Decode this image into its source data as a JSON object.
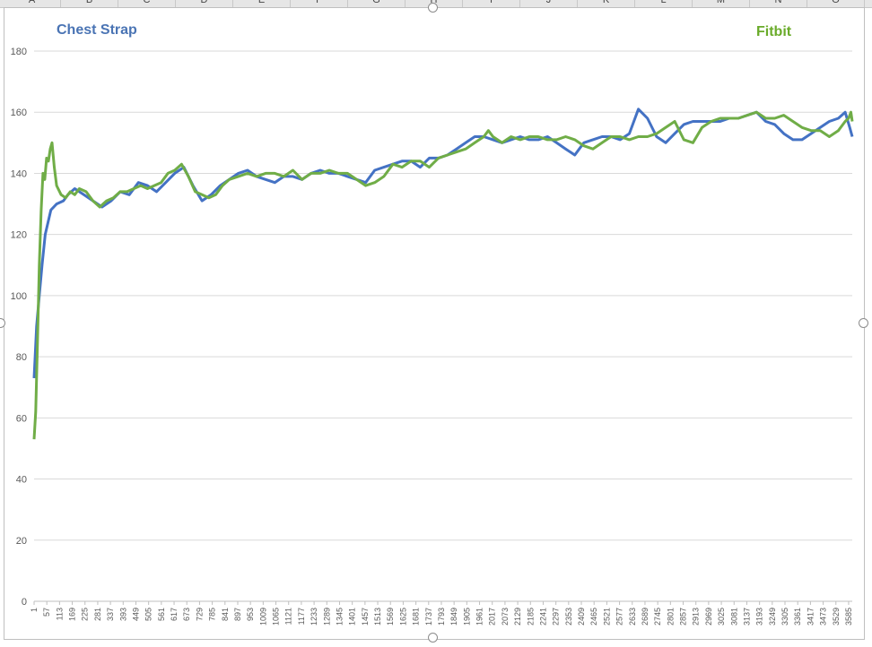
{
  "sheet": {
    "columns": [
      "A",
      "B",
      "C",
      "D",
      "E",
      "F",
      "G",
      "H",
      "I",
      "J",
      "K",
      "L",
      "M",
      "N",
      "O"
    ]
  },
  "legend": {
    "chest_strap": "Chest Strap",
    "fitbit": "Fitbit"
  },
  "colors": {
    "chest_strap": "#4472c4",
    "fitbit": "#70ad47",
    "legend_blue": "#4a74b4",
    "legend_green": "#6aab2a",
    "grid": "#d9d9d9"
  },
  "chart_data": {
    "type": "line",
    "title": "",
    "xlabel": "",
    "ylabel": "",
    "ylim": [
      0,
      180
    ],
    "yticks": [
      0,
      20,
      40,
      60,
      80,
      100,
      120,
      140,
      160,
      180
    ],
    "xlim": [
      1,
      3601
    ],
    "xticks": [
      "1",
      "57",
      "113",
      "169",
      "225",
      "281",
      "337",
      "393",
      "449",
      "505",
      "561",
      "617",
      "673",
      "729",
      "785",
      "841",
      "897",
      "953",
      "1009",
      "1065",
      "1121",
      "1177",
      "1233",
      "1289",
      "1345",
      "1401",
      "1457",
      "1513",
      "1569",
      "1625",
      "1681",
      "1737",
      "1793",
      "1849",
      "1905",
      "1961",
      "2017",
      "2073",
      "2129",
      "2185",
      "2241",
      "2297",
      "2353",
      "2409",
      "2465",
      "2521",
      "2577",
      "2633",
      "2689",
      "2745",
      "2801",
      "2857",
      "2913",
      "2969",
      "3025",
      "3081",
      "3137",
      "3193",
      "3249",
      "3305",
      "3361",
      "3417",
      "3473",
      "3529",
      "3585"
    ],
    "grid": true,
    "legend_placement": "top",
    "series": [
      {
        "name": "Chest Strap",
        "x": [
          1,
          12,
          24,
          36,
          50,
          75,
          100,
          130,
          150,
          180,
          220,
          260,
          300,
          340,
          380,
          420,
          460,
          500,
          540,
          580,
          620,
          660,
          700,
          740,
          780,
          820,
          860,
          900,
          940,
          980,
          1020,
          1060,
          1100,
          1140,
          1180,
          1220,
          1260,
          1300,
          1340,
          1380,
          1420,
          1460,
          1500,
          1540,
          1580,
          1620,
          1660,
          1700,
          1740,
          1780,
          1820,
          1860,
          1900,
          1940,
          1980,
          2020,
          2060,
          2100,
          2140,
          2180,
          2220,
          2260,
          2300,
          2340,
          2380,
          2420,
          2460,
          2500,
          2540,
          2580,
          2620,
          2660,
          2700,
          2740,
          2780,
          2820,
          2860,
          2900,
          2940,
          2980,
          3020,
          3060,
          3100,
          3140,
          3180,
          3220,
          3260,
          3300,
          3340,
          3380,
          3420,
          3460,
          3500,
          3540,
          3570,
          3590,
          3601
        ],
        "y": [
          73,
          90,
          100,
          110,
          120,
          128,
          130,
          131,
          133,
          135,
          133,
          131,
          129,
          131,
          134,
          133,
          137,
          136,
          134,
          137,
          140,
          142,
          136,
          131,
          133,
          136,
          138,
          140,
          141,
          139,
          138,
          137,
          139,
          139,
          138,
          140,
          141,
          140,
          140,
          139,
          138,
          137,
          141,
          142,
          143,
          144,
          144,
          142,
          145,
          145,
          146,
          148,
          150,
          152,
          152,
          151,
          150,
          151,
          152,
          151,
          151,
          152,
          150,
          148,
          146,
          150,
          151,
          152,
          152,
          151,
          153,
          161,
          158,
          152,
          150,
          153,
          156,
          157,
          157,
          157,
          157,
          158,
          158,
          159,
          160,
          157,
          156,
          153,
          151,
          151,
          153,
          155,
          157,
          158,
          160,
          155,
          152
        ]
      },
      {
        "name": "Fitbit",
        "x": [
          1,
          8,
          16,
          24,
          32,
          40,
          48,
          56,
          64,
          72,
          80,
          90,
          100,
          120,
          140,
          160,
          180,
          200,
          230,
          260,
          290,
          320,
          350,
          380,
          410,
          440,
          470,
          500,
          530,
          560,
          590,
          620,
          650,
          680,
          710,
          740,
          770,
          800,
          830,
          860,
          900,
          940,
          980,
          1020,
          1060,
          1100,
          1140,
          1180,
          1220,
          1260,
          1300,
          1340,
          1380,
          1420,
          1460,
          1500,
          1540,
          1580,
          1620,
          1660,
          1700,
          1740,
          1780,
          1820,
          1860,
          1900,
          1940,
          1980,
          2000,
          2020,
          2060,
          2100,
          2140,
          2180,
          2220,
          2260,
          2300,
          2340,
          2380,
          2420,
          2460,
          2500,
          2540,
          2580,
          2620,
          2660,
          2700,
          2740,
          2780,
          2820,
          2860,
          2900,
          2940,
          2980,
          3020,
          3060,
          3100,
          3140,
          3180,
          3220,
          3260,
          3300,
          3340,
          3380,
          3420,
          3460,
          3500,
          3540,
          3570,
          3585,
          3595,
          3601
        ],
        "y": [
          53,
          62,
          85,
          110,
          128,
          140,
          138,
          145,
          144,
          148,
          150,
          142,
          136,
          133,
          132,
          134,
          133,
          135,
          134,
          131,
          129,
          131,
          132,
          134,
          134,
          135,
          136,
          135,
          136,
          137,
          140,
          141,
          143,
          139,
          134,
          133,
          132,
          133,
          136,
          138,
          139,
          140,
          139,
          140,
          140,
          139,
          141,
          138,
          140,
          140,
          141,
          140,
          140,
          138,
          136,
          137,
          139,
          143,
          142,
          144,
          144,
          142,
          145,
          146,
          147,
          148,
          150,
          152,
          154,
          152,
          150,
          152,
          151,
          152,
          152,
          151,
          151,
          152,
          151,
          149,
          148,
          150,
          152,
          152,
          151,
          152,
          152,
          153,
          155,
          157,
          151,
          150,
          155,
          157,
          158,
          158,
          158,
          159,
          160,
          158,
          158,
          159,
          157,
          155,
          154,
          154,
          152,
          154,
          157,
          158,
          160,
          157
        ]
      }
    ]
  }
}
